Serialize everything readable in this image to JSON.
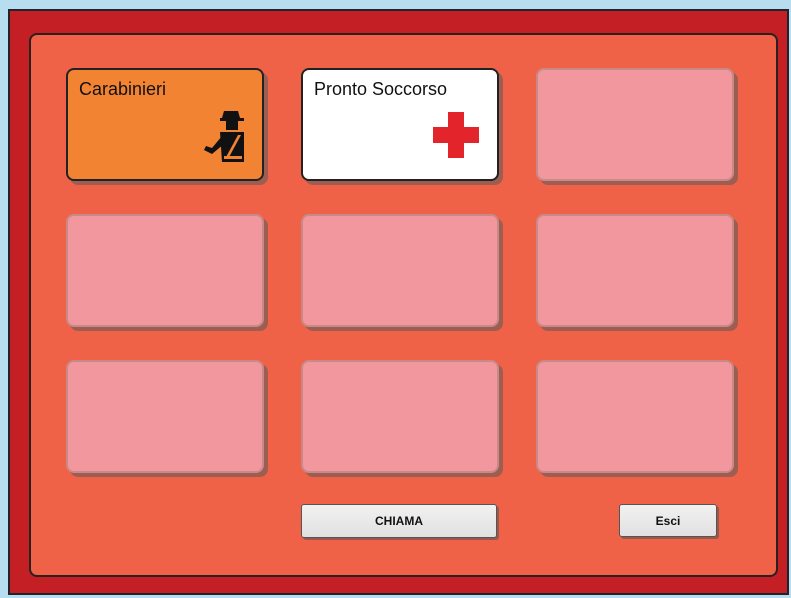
{
  "colors": {
    "background": "#b7def0",
    "frame": "#c41f25",
    "panel": "#ef6248",
    "empty_tile": "#f3979f",
    "carabinieri_tile": "#f28333",
    "soccorso_tile": "#ffffff",
    "cross": "#e3242b"
  },
  "tiles": [
    {
      "label": "Carabinieri",
      "icon": "carabiniere-icon"
    },
    {
      "label": "Pronto Soccorso",
      "icon": "red-cross-icon"
    },
    {
      "label": "",
      "icon": ""
    },
    {
      "label": "",
      "icon": ""
    },
    {
      "label": "",
      "icon": ""
    },
    {
      "label": "",
      "icon": ""
    },
    {
      "label": "",
      "icon": ""
    },
    {
      "label": "",
      "icon": ""
    },
    {
      "label": "",
      "icon": ""
    }
  ],
  "buttons": {
    "call_label": "CHIAMA",
    "exit_label": "Esci"
  }
}
